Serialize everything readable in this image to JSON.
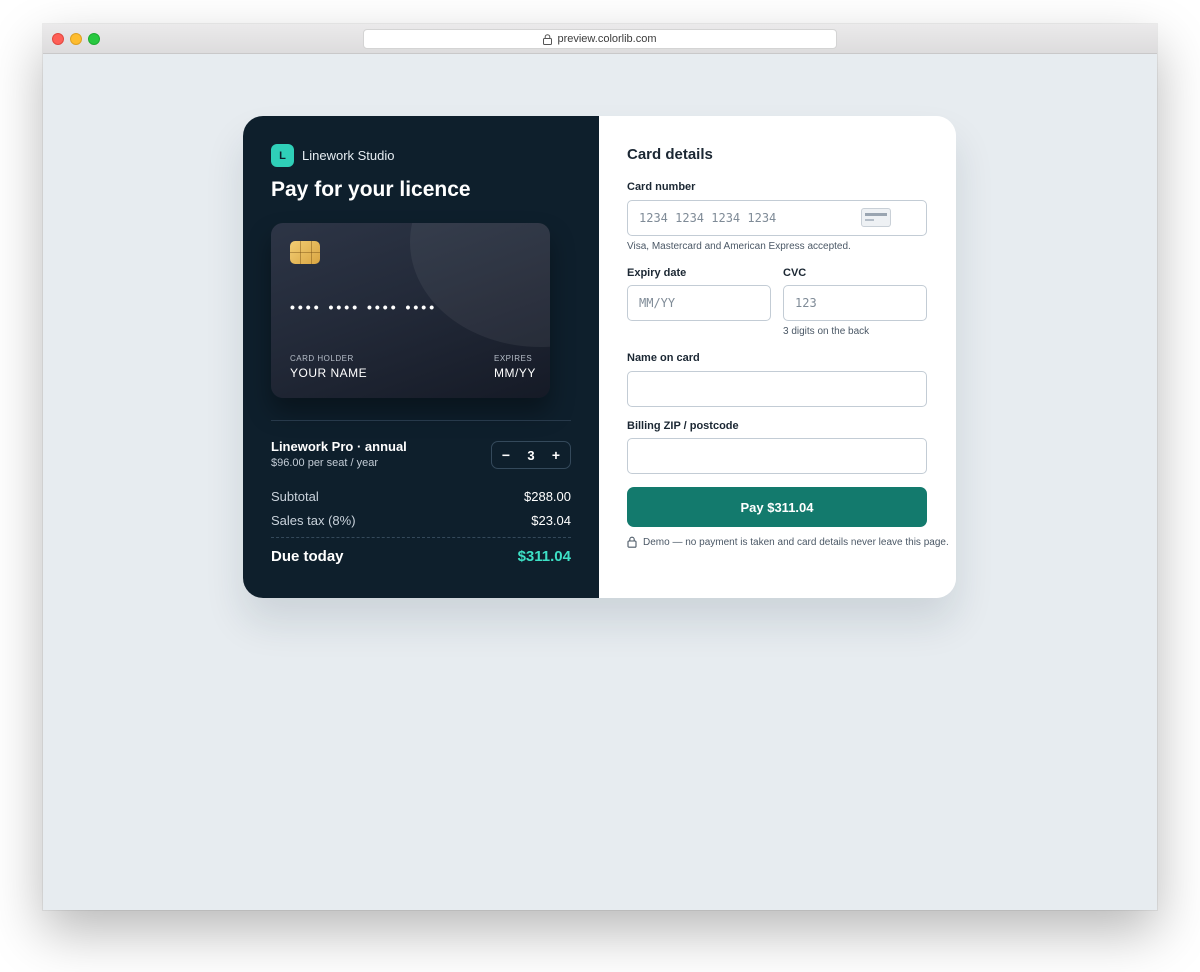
{
  "browser": {
    "url": "preview.colorlib.com"
  },
  "summary": {
    "brand_initial": "L",
    "brand_name": "Linework Studio",
    "headline": "Pay for your licence",
    "credit_card": {
      "number": "•••• •••• •••• ••••",
      "holder_label": "CARD HOLDER",
      "holder_value": "YOUR NAME",
      "expires_label": "EXPIRES",
      "expires_value": "MM/YY"
    },
    "product": {
      "name": "Linework Pro · annual",
      "price": "$96.00 per seat / year",
      "quantity": "3",
      "decrement": "−",
      "increment": "+"
    },
    "subtotal_label": "Subtotal",
    "subtotal_value": "$288.00",
    "tax_label": "Sales tax (8%)",
    "tax_value": "$23.04",
    "due_label": "Due today",
    "due_value": "$311.04"
  },
  "form": {
    "title": "Card details",
    "card_number_label": "Card number",
    "card_number_placeholder": "1234 1234 1234 1234",
    "card_number_hint": "Visa, Mastercard and American Express accepted.",
    "expiry_label": "Expiry date",
    "expiry_placeholder": "MM/YY",
    "cvc_label": "CVC",
    "cvc_placeholder": "123",
    "cvc_hint": "3 digits on the back",
    "name_label": "Name on card",
    "name_value": "",
    "zip_label": "Billing ZIP / postcode",
    "zip_value": "",
    "pay_button": "Pay $311.04",
    "footnote": "Demo — no payment is taken and card details never leave this page."
  },
  "colors": {
    "panel_dark": "#0e1f2c",
    "accent_teal": "#2fcfb8",
    "pay_button": "#137a6d",
    "due_amount": "#3de0c5"
  }
}
